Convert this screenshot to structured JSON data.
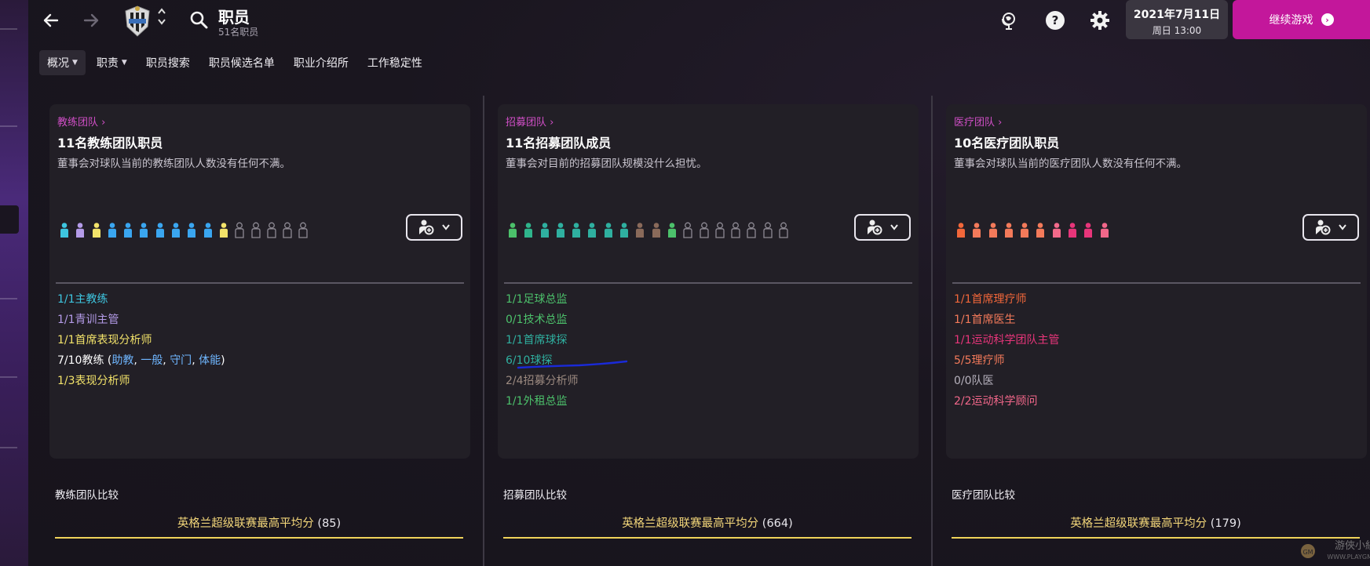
{
  "header": {
    "title": "职员",
    "subtitle": "51名职员"
  },
  "date": {
    "line1": "2021年7月11日",
    "line2": "周日 13:00"
  },
  "continue_label": "继续游戏",
  "tabs": [
    {
      "label": "概况",
      "has_dropdown": true,
      "active": true
    },
    {
      "label": "职责",
      "has_dropdown": true,
      "active": false
    },
    {
      "label": "职员搜索",
      "has_dropdown": false,
      "active": false
    },
    {
      "label": "职员候选名单",
      "has_dropdown": false,
      "active": false
    },
    {
      "label": "职业介绍所",
      "has_dropdown": false,
      "active": false
    },
    {
      "label": "工作稳定性",
      "has_dropdown": false,
      "active": false
    }
  ],
  "panels": [
    {
      "breadcrumb": "教练团队",
      "title": "11名教练团队职员",
      "description": "董事会对球队当前的教练团队人数没有任何不满。",
      "people_colors": [
        "#3ec6e0",
        "#b49be8",
        "#f3e36a",
        "#3aa6f0",
        "#3aa6f0",
        "#3aa6f0",
        "#3aa6f0",
        "#3aa6f0",
        "#3aa6f0",
        "#3aa6f0",
        "#f3e36a"
      ],
      "empty_slots": 5,
      "roles": [
        {
          "count": "1/1",
          "label": "主教练",
          "color": "#3ec6e0"
        },
        {
          "count": "1/1",
          "label": "青训主管",
          "color": "#b49be8"
        },
        {
          "count": "1/1",
          "label": "首席表现分析师",
          "color": "#f3e36a"
        },
        {
          "count": "7/10",
          "label": "教练",
          "color": "#ffffff",
          "paren_open": " (",
          "links": [
            {
              "text": "助教",
              "color": "#6fb6ff"
            },
            {
              "text": "一般",
              "color": "#6fb6ff"
            },
            {
              "text": "守门",
              "color": "#6fb6ff"
            },
            {
              "text": "体能",
              "color": "#6fb6ff"
            }
          ],
          "paren_close": ")"
        },
        {
          "count": "1/3",
          "label": "表现分析师",
          "color": "#f3e36a"
        }
      ],
      "comparison_label": "教练团队比较",
      "comparison_text": "英格兰超级联赛最高平均分",
      "comparison_value": "(85)"
    },
    {
      "breadcrumb": "招募团队",
      "title": "11名招募团队成员",
      "description": "董事会对目前的招募团队规模没什么担忧。",
      "people_colors": [
        "#4cc16b",
        "#2fb58c",
        "#2fb0a0",
        "#2fb0a0",
        "#2fb0a0",
        "#2fb0a0",
        "#2fb0a0",
        "#2fb0a0",
        "#8a6a5a",
        "#8a6a5a",
        "#4cc16b"
      ],
      "empty_slots": 7,
      "roles": [
        {
          "count": "1/1",
          "label": "足球总监",
          "color": "#4cc16b"
        },
        {
          "count": "0/1",
          "label": "技术总监",
          "color": "#4cc16b"
        },
        {
          "count": "1/1",
          "label": "首席球探",
          "color": "#2fb0a0"
        },
        {
          "count": "6/10",
          "label": "球探",
          "color": "#2fb0a0"
        },
        {
          "count": "2/4",
          "label": "招募分析师",
          "color": "#9c8a80"
        },
        {
          "count": "1/1",
          "label": "外租总监",
          "color": "#4cc16b"
        }
      ],
      "comparison_label": "招募团队比较",
      "comparison_text": "英格兰超级联赛最高平均分",
      "comparison_value": "(664)"
    },
    {
      "breadcrumb": "医疗团队",
      "title": "10名医疗团队职员",
      "description": "董事会对球队当前的医疗团队人数没有任何不满。",
      "people_colors": [
        "#f2673a",
        "#f47a5a",
        "#f47a5a",
        "#f47a5a",
        "#f47a5a",
        "#f47a5a",
        "#f26a8a",
        "#e8357a",
        "#e8357a",
        "#f2678a"
      ],
      "empty_slots": 0,
      "roles": [
        {
          "count": "1/1",
          "label": "首席理疗师",
          "color": "#f2673a"
        },
        {
          "count": "1/1",
          "label": "首席医生",
          "color": "#f47a5a"
        },
        {
          "count": "1/1",
          "label": "运动科学团队主管",
          "color": "#e8357a"
        },
        {
          "count": "5/5",
          "label": "理疗师",
          "color": "#f47a5a"
        },
        {
          "count": "0/0",
          "label": "队医",
          "color": "#b7b2bd"
        },
        {
          "count": "2/2",
          "label": "运动科学顾问",
          "color": "#f2678a"
        }
      ],
      "comparison_label": "医疗团队比较",
      "comparison_text": "英格兰超级联赛最高平均分",
      "comparison_value": "(179)"
    }
  ],
  "watermark_text": "游俠小組 WWW.PLAYGM.CC",
  "icons": {
    "back": "back-arrow-icon",
    "forward": "forward-arrow-icon",
    "search": "search-icon",
    "help": "help-icon",
    "settings": "gear-icon",
    "globe": "globe-icon"
  }
}
